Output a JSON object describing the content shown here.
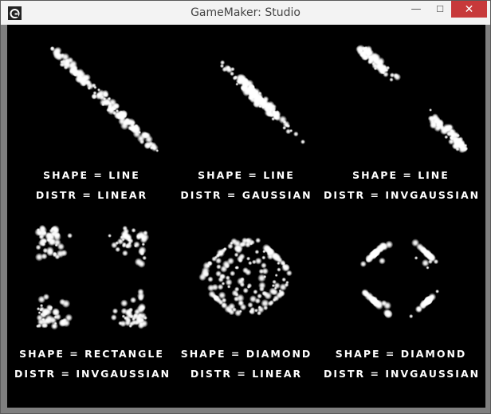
{
  "window": {
    "title": "GameMaker: Studio",
    "min_glyph": "—",
    "max_glyph": "☐",
    "close_glyph": "✕"
  },
  "colors": {
    "titlebar": "#f3f3f3",
    "close": "#c7393a",
    "canvas": "#000000",
    "particle": "#ffffff"
  },
  "demos": [
    {
      "shape_label": "SHAPE = LINE",
      "distr_label": "DISTR = LINEAR",
      "shape": "line",
      "distribution": "linear"
    },
    {
      "shape_label": "SHAPE = LINE",
      "distr_label": "DISTR = GAUSSIAN",
      "shape": "line",
      "distribution": "gaussian"
    },
    {
      "shape_label": "SHAPE = LINE",
      "distr_label": "DISTR = INVGAUSSIAN",
      "shape": "line",
      "distribution": "invgaussian"
    },
    {
      "shape_label": "SHAPE = RECTANGLE",
      "distr_label": "DISTR = INVGAUSSIAN",
      "shape": "rectangle",
      "distribution": "invgaussian"
    },
    {
      "shape_label": "SHAPE = DIAMOND",
      "distr_label": "DISTR = LINEAR",
      "shape": "diamond",
      "distribution": "linear"
    },
    {
      "shape_label": "SHAPE = DIAMOND",
      "distr_label": "DISTR = INVGAUSSIAN",
      "shape": "diamond",
      "distribution": "invgaussian"
    }
  ]
}
